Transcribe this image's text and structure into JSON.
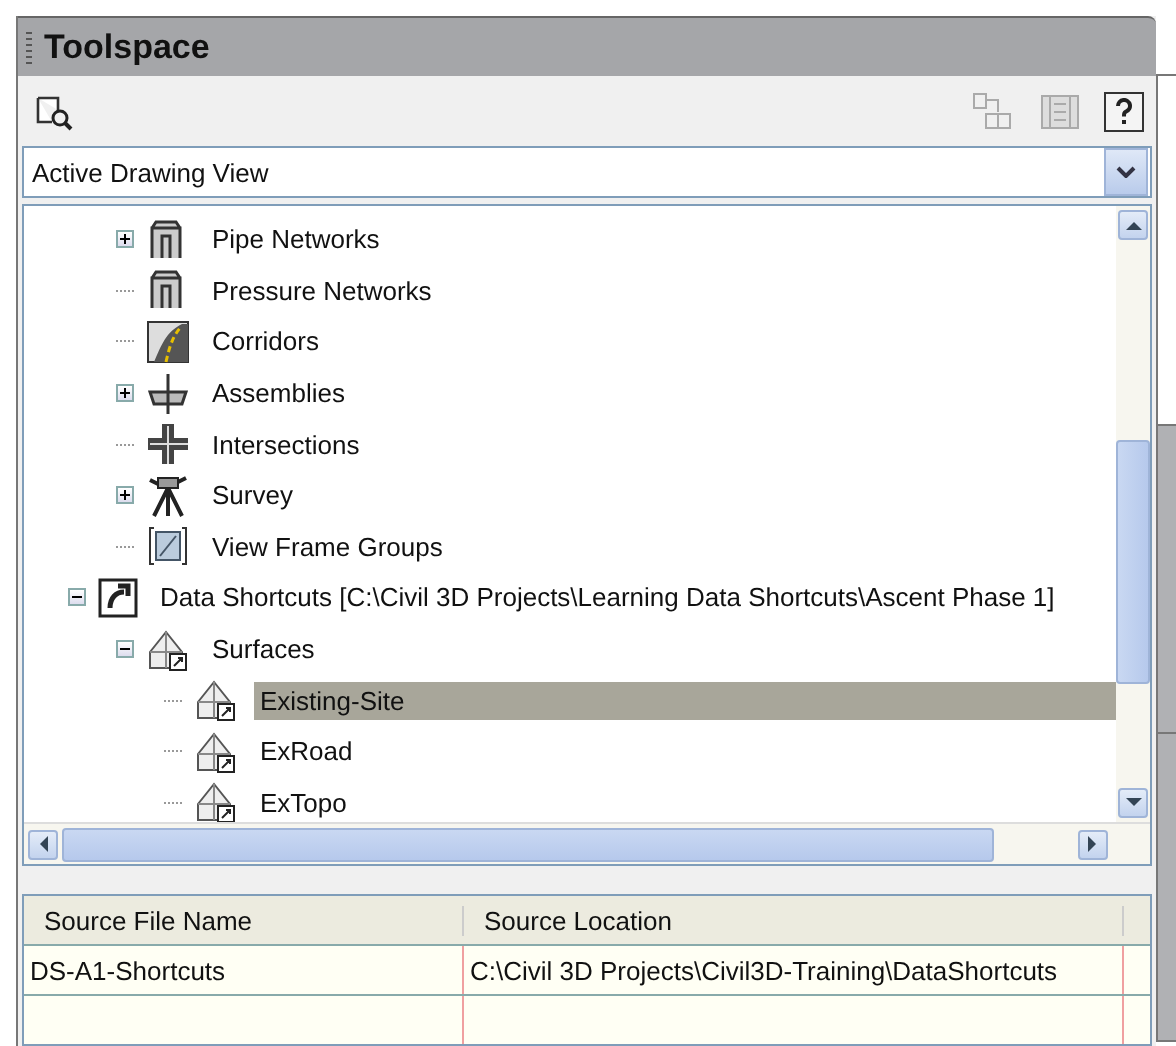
{
  "window": {
    "title": "Toolspace"
  },
  "view_dropdown": {
    "value": "Active Drawing View"
  },
  "tree": {
    "continued_items": [
      {
        "label": "Pipe Networks",
        "kind": "pipe",
        "expanded": false,
        "selected": false
      },
      {
        "label": "Pressure Networks",
        "kind": "pressure",
        "selected": false
      },
      {
        "label": "Corridors",
        "kind": "corridor",
        "selected": false
      },
      {
        "label": "Assemblies",
        "kind": "assembly",
        "expanded": false,
        "selected": false
      },
      {
        "label": "Intersections",
        "kind": "intersection",
        "selected": false
      },
      {
        "label": "Survey",
        "kind": "survey",
        "expanded": false,
        "selected": false
      },
      {
        "label": "View Frame Groups",
        "kind": "viewframe",
        "selected": false
      }
    ],
    "items": [
      {
        "label": "Data Shortcuts [C:\\Civil 3D Projects\\Learning Data Shortcuts\\Ascent Phase 1]",
        "kind": "shortcut",
        "expanded": true,
        "selected": false,
        "children": [
          {
            "label": "Surfaces",
            "kind": "surface",
            "expanded": true,
            "selected": false,
            "children": [
              {
                "label": "Existing-Site",
                "kind": "surface",
                "selected": true
              },
              {
                "label": "ExRoad",
                "kind": "surface",
                "selected": false
              },
              {
                "label": "ExTopo",
                "kind": "surface",
                "selected": false
              }
            ]
          }
        ]
      }
    ]
  },
  "table": {
    "columns": [
      "Source File Name",
      "Source Location"
    ],
    "rows": [
      [
        "DS-A1-Shortcuts",
        "C:\\Civil 3D Projects\\Civil3D-Training\\DataShortcuts"
      ]
    ]
  },
  "side_tabs": [
    {
      "selected": true
    },
    {
      "selected": false
    },
    {
      "selected": false
    }
  ]
}
